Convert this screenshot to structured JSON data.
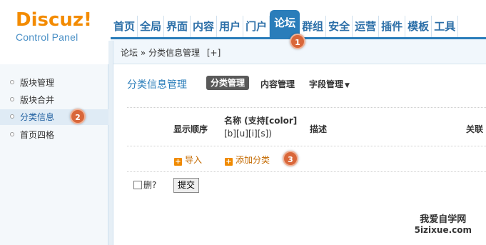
{
  "logo": {
    "main": "Discuz!",
    "sub": "Control Panel"
  },
  "nav": {
    "items": [
      "首页",
      "全局",
      "界面",
      "内容",
      "用户",
      "门户",
      "论坛",
      "群组",
      "安全",
      "运营",
      "插件",
      "模板",
      "工具"
    ],
    "active": "论坛"
  },
  "breadcrumb": {
    "root": "论坛",
    "sep": "»",
    "current": "分类信息管理",
    "add": "[+]"
  },
  "sidebar": {
    "items": [
      {
        "label": "版块管理"
      },
      {
        "label": "版块合并"
      },
      {
        "label": "分类信息"
      },
      {
        "label": "首页四格"
      }
    ],
    "active": "分类信息"
  },
  "main": {
    "title": "分类信息管理",
    "subtabs": [
      {
        "label": "分类管理",
        "active": true
      },
      {
        "label": "内容管理"
      },
      {
        "label": "字段管理",
        "dropdown": true
      }
    ],
    "table": {
      "headers": {
        "order": "显示顺序",
        "name_line1": "名称 (支持[color]",
        "name_line2": "[b][u][i][s])",
        "desc": "描述",
        "related": "关联"
      },
      "import_label": "导入",
      "add_label": "添加分类"
    },
    "delete_label": "删?",
    "submit_label": "提交"
  },
  "markers": [
    "1",
    "2",
    "3"
  ],
  "watermark": {
    "line1": "我爱自学网",
    "line2": "5izixue.com"
  }
}
